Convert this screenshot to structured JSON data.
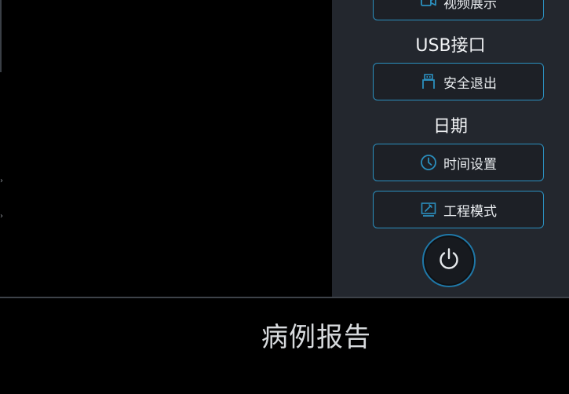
{
  "side_panel": {
    "video_button_label": "视频展示",
    "usb_section_label": "USB接口",
    "safe_eject_label": "安全退出",
    "date_section_label": "日期",
    "time_settings_label": "时间设置",
    "engineering_mode_label": "工程模式"
  },
  "bottom": {
    "title": "病例报告"
  },
  "colors": {
    "accent": "#2b8fbe",
    "panel_bg": "#23272e",
    "button_bg": "#1d2026"
  },
  "icons": {
    "video": "video-icon",
    "usb": "usb-icon",
    "clock": "clock-icon",
    "engineering": "engineering-icon",
    "power": "power-icon"
  }
}
